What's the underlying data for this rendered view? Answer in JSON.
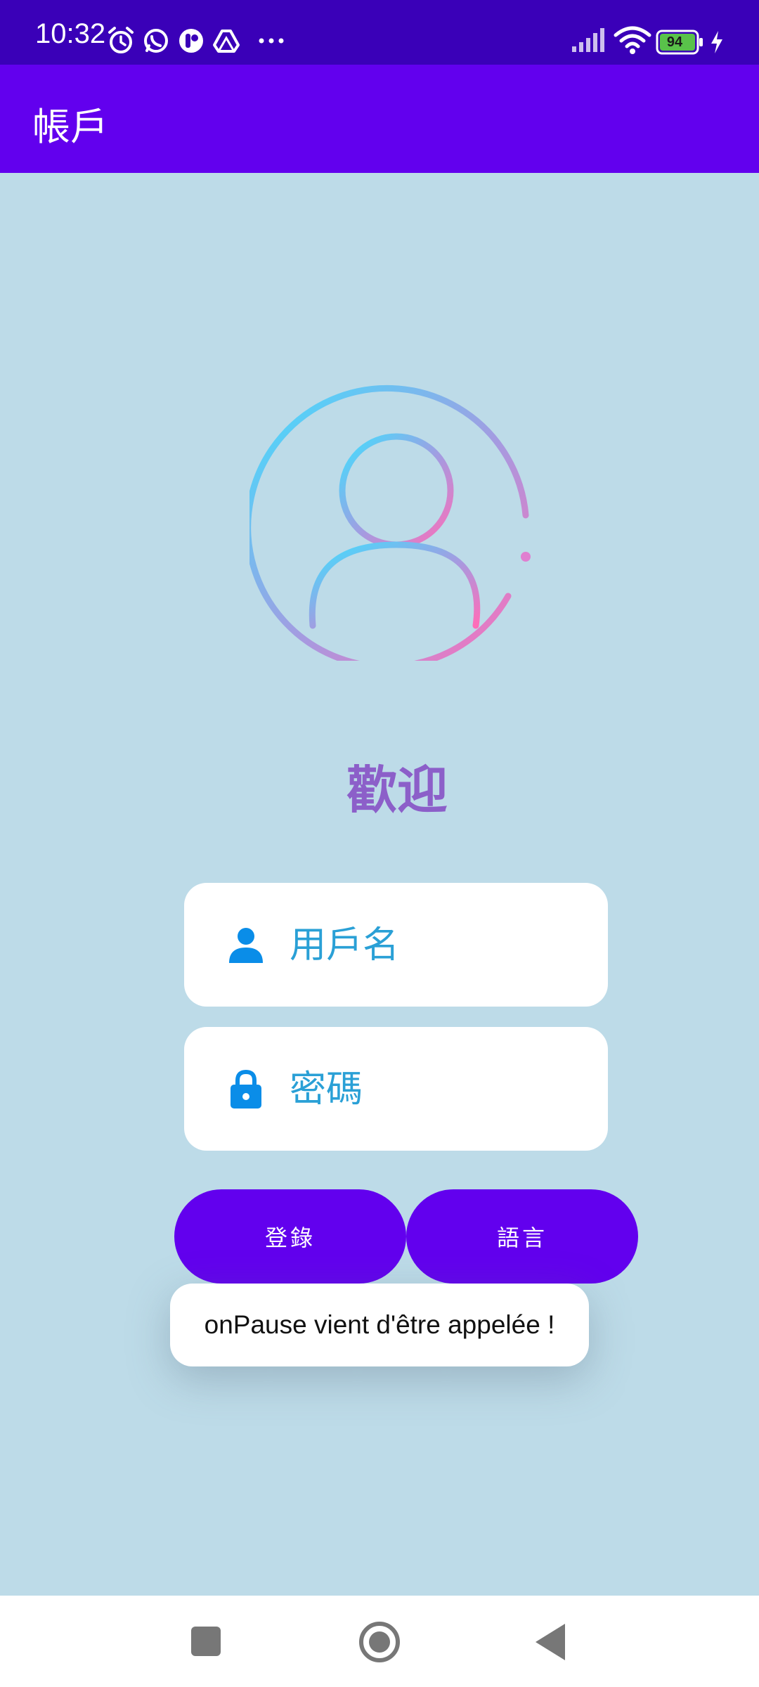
{
  "status_bar": {
    "time": "10:32",
    "battery_level": "94",
    "background_color": "#3a00b8",
    "icons": [
      "alarm-icon",
      "whatsapp-icon",
      "app-icon",
      "drive-icon",
      "more-icon",
      "signal-icon",
      "wifi-icon",
      "battery-icon",
      "charging-icon"
    ],
    "more_label": "···"
  },
  "app_bar": {
    "title": "帳戶",
    "background_color": "#6200ee"
  },
  "login": {
    "avatar_icon": "user-circle-gradient-icon",
    "welcome": "歡迎",
    "username_placeholder": "用戶名",
    "username_value": "",
    "password_placeholder": "密碼",
    "password_value": "",
    "username_icon": "person-icon",
    "password_icon": "lock-icon",
    "login_button": "登錄",
    "language_button": "語言"
  },
  "toast": {
    "message": "onPause vient d'être appelée !"
  },
  "nav_bar": {
    "buttons": [
      "recents-square-icon",
      "home-circle-icon",
      "back-triangle-icon"
    ]
  },
  "colors": {
    "background": "#bddbe8",
    "accent": "#6200ee",
    "field_text": "#2aa0d6",
    "welcome_text": "#8c5fc9"
  }
}
